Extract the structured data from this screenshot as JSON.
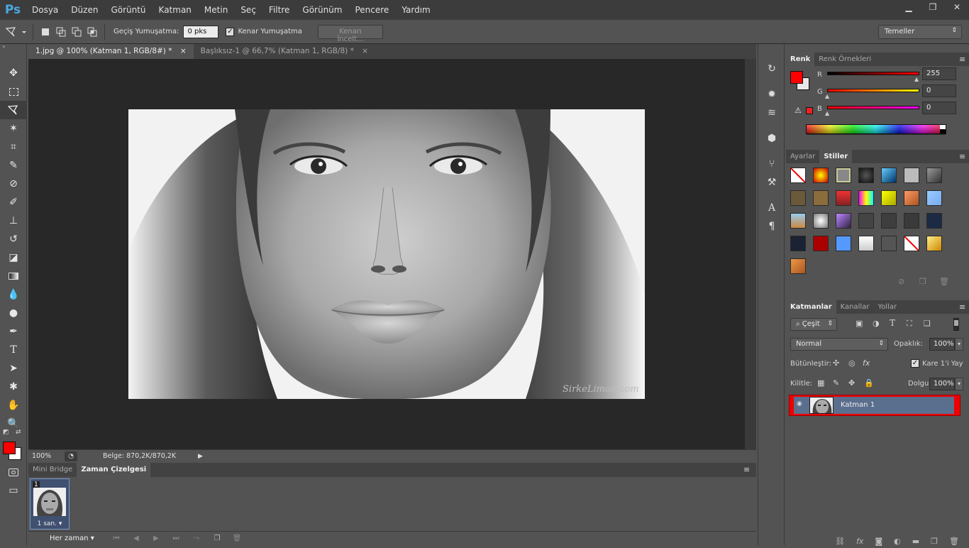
{
  "app": {
    "logo": "Ps"
  },
  "menu": [
    "Dosya",
    "Düzen",
    "Görüntü",
    "Katman",
    "Metin",
    "Seç",
    "Filtre",
    "Görünüm",
    "Pencere",
    "Yardım"
  ],
  "window_controls": {
    "minimize": "▁",
    "restore": "❐",
    "close": "✕"
  },
  "options": {
    "feather_label": "Geçiş Yumuşatma:",
    "feather_value": "0 pks",
    "antialias_label": "Kenar Yumuşatma",
    "refine_button": "Kenarı İncelt...",
    "workspace": "Temeller"
  },
  "tabs": [
    {
      "label": "1.jpg @ 100% (Katman 1, RGB/8#) *",
      "close": "×"
    },
    {
      "label": "Başlıksız-1 @ 66,7% (Katman 1, RGB/8) *",
      "close": "×"
    }
  ],
  "photo": {
    "watermark": "SirkeLimon.com"
  },
  "status": {
    "zoom": "100%",
    "doc": "Belge: 870,2K/870,2K"
  },
  "bottom_panel": {
    "tabs": [
      "Mini Bridge",
      "Zaman Çizelgesi"
    ],
    "frame_number": "1",
    "frame_time": "1 san.",
    "loop": "Her zaman"
  },
  "color_panel": {
    "tabs": [
      "Renk",
      "Renk Örnekleri"
    ],
    "channels": [
      {
        "label": "R",
        "value": "255"
      },
      {
        "label": "G",
        "value": "0"
      },
      {
        "label": "B",
        "value": "0"
      }
    ],
    "foreground": "#ff0000",
    "background": "#ffffff"
  },
  "styles_panel": {
    "tabs": [
      "Ayarlar",
      "Stiller"
    ]
  },
  "layers_panel": {
    "tabs": [
      "Katmanlar",
      "Kanallar",
      "Yollar"
    ],
    "filter": "Çeşit",
    "blend_mode": "Normal",
    "opacity_label": "Opaklık:",
    "opacity_value": "100%",
    "unify_label": "Bütünleştir:",
    "propagate_label": "Kare 1'i Yay",
    "lock_label": "Kilitle:",
    "fill_label": "Dolgu:",
    "fill_value": "100%",
    "layer_name": "Katman 1"
  }
}
